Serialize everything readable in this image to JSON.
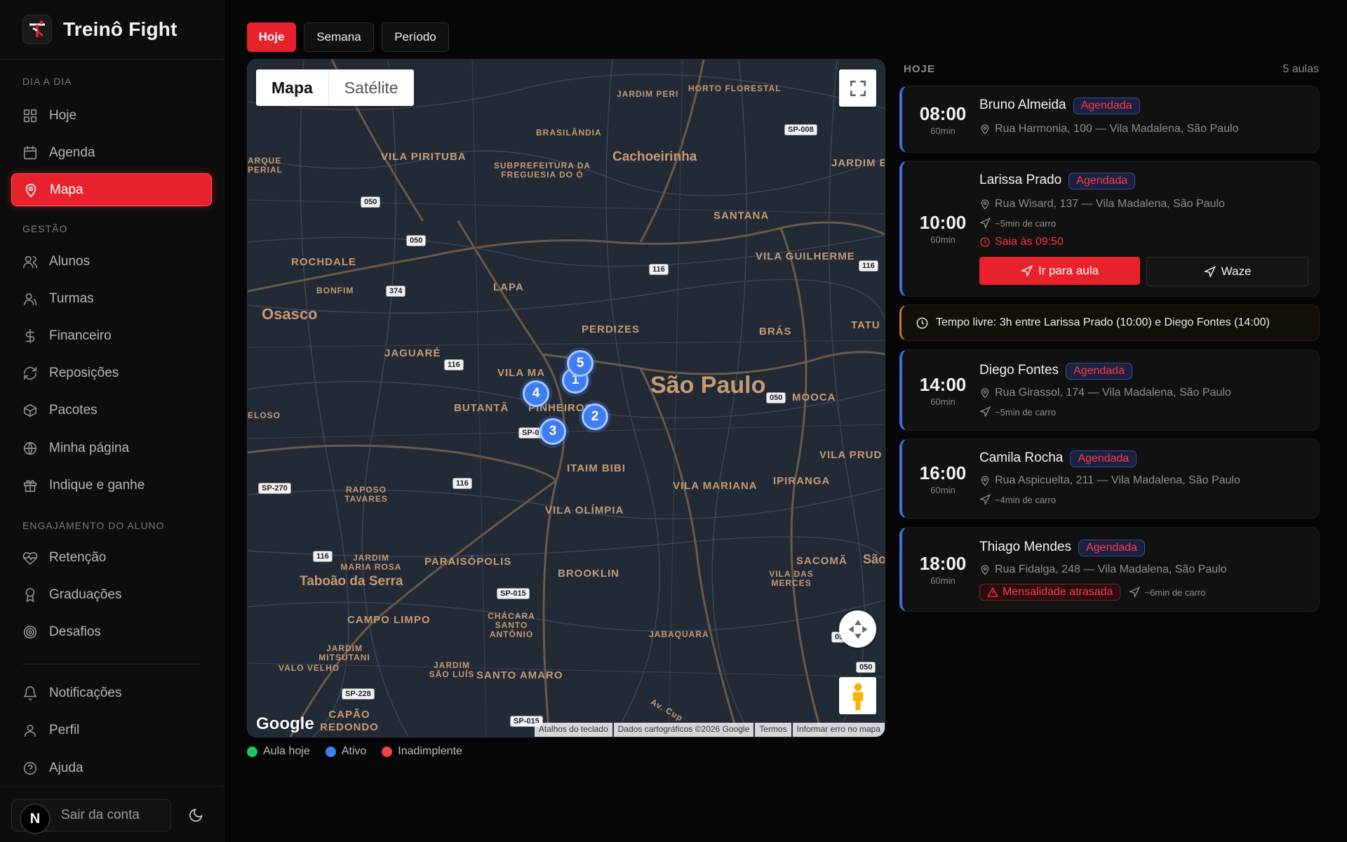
{
  "brand": {
    "name": "Treinô Fight"
  },
  "sidebar": {
    "sections": [
      "DIA A DIA",
      "GESTÃO",
      "ENGAJAMENTO DO ALUNO"
    ],
    "items": [
      {
        "label": "Hoje",
        "icon": "grid-icon"
      },
      {
        "label": "Agenda",
        "icon": "calendar-icon"
      },
      {
        "label": "Mapa",
        "icon": "map-pin-icon",
        "active": true
      },
      {
        "label": "Alunos",
        "icon": "users-icon"
      },
      {
        "label": "Turmas",
        "icon": "users-group-icon"
      },
      {
        "label": "Financeiro",
        "icon": "dollar-icon"
      },
      {
        "label": "Reposições",
        "icon": "refresh-icon"
      },
      {
        "label": "Pacotes",
        "icon": "box-icon"
      },
      {
        "label": "Minha página",
        "icon": "globe-icon"
      },
      {
        "label": "Indique e ganhe",
        "icon": "gift-icon"
      },
      {
        "label": "Retenção",
        "icon": "heart-pulse-icon"
      },
      {
        "label": "Graduações",
        "icon": "award-icon"
      },
      {
        "label": "Desafios",
        "icon": "target-icon"
      },
      {
        "label": "Notificações",
        "icon": "bell-icon"
      },
      {
        "label": "Perfil",
        "icon": "user-icon"
      },
      {
        "label": "Ajuda",
        "icon": "help-icon"
      }
    ],
    "avatar_letter": "N",
    "logout_label": "Sair da conta"
  },
  "tabs": [
    "Hoje",
    "Semana",
    "Período"
  ],
  "map": {
    "toggle": [
      "Mapa",
      "Satélite"
    ],
    "clusters": [
      "1",
      "2",
      "3",
      "4",
      "5"
    ],
    "labels": [
      "São Paulo",
      "Osasco",
      "Cachoeirinha",
      "Taboão da Serra",
      "VILA PIRITUBA",
      "ROCHDALE",
      "LAPA",
      "PERDIZES",
      "SANTANA",
      "VILA GUILHERME",
      "BRÁS",
      "JAGUARÉ",
      "VILA MARIANA",
      "BUTANTÃ",
      "PINHEIROS",
      "ITAIM BIBI",
      "MOOCA",
      "VILA OLÍMPIA",
      "IPIRANGA",
      "PARAISÓPOLIS",
      "BROOKLIN",
      "CAMPO LIMPO",
      "SANTO AMARO",
      "SACOMÃ",
      "CAPÃO REDONDO",
      "BRASILÂNDIA",
      "JARDIM PERI",
      "HORTO FLORESTAL",
      "SUBPREFEITURA DA FREGUESIA DO Ó",
      "BONFIM",
      "RAPOSO TAVARES",
      "JARDIM MARIA ROSA",
      "CHÁCARA SANTO ANTÔNIO",
      "JABAQUARA",
      "VILA DAS MERCES",
      "JARDIM MITSUTANI",
      "VALO VELHO",
      "JARDIM SÃO LUÍS",
      "VILA PRUD",
      "TATU",
      "JARDIM E",
      "ELOSO",
      "ARQUE PERIAL",
      "Av. Cup",
      "VILA MA",
      "São"
    ],
    "shields": [
      "SP-008",
      "050",
      "050",
      "116",
      "116",
      "374",
      "116",
      "050",
      "116",
      "SP-270",
      "116",
      "SP-015",
      "SP-228",
      "SP-015",
      "SP-0",
      "050",
      "05"
    ],
    "google": "Google",
    "attribution": [
      "Atalhos do teclado",
      "Dados cartográficos ©2026 Google",
      "Termos",
      "Informar erro no mapa"
    ]
  },
  "legend": [
    {
      "label": "Aula hoje",
      "color": "#22c55e"
    },
    {
      "label": "Ativo",
      "color": "#3b82f6"
    },
    {
      "label": "Inadimplente",
      "color": "#ef4444"
    }
  ],
  "panel": {
    "title": "HOJE",
    "count": "5 aulas",
    "status_label": "Agendada",
    "classes": [
      {
        "time": "08:00",
        "dur": "60min",
        "name": "Bruno Almeida",
        "address": "Rua Harmonia, 100 — Vila Madalena, São Paulo"
      },
      {
        "time": "10:00",
        "dur": "60min",
        "name": "Larissa Prado",
        "address": "Rua Wisard, 137 — Vila Madalena, São Paulo",
        "drive": "~5min de carro",
        "leave": "Saia às 09:50",
        "go_label": "Ir para aula",
        "waze_label": "Waze"
      },
      {
        "time": "14:00",
        "dur": "60min",
        "name": "Diego Fontes",
        "address": "Rua Girassol, 174 — Vila Madalena, São Paulo",
        "drive": "~5min de carro"
      },
      {
        "time": "16:00",
        "dur": "60min",
        "name": "Camila Rocha",
        "address": "Rua Aspicuelta, 211 — Vila Madalena, São Paulo",
        "drive": "~4min de carro"
      },
      {
        "time": "18:00",
        "dur": "60min",
        "name": "Thiago Mendes",
        "address": "Rua Fidalga, 248 — Vila Madalena, São Paulo",
        "alert": "Mensalidade atrasada",
        "drive": "~6min de carro"
      }
    ],
    "free_time": "Tempo livre: 3h entre Larissa Prado (10:00) e Diego Fontes (14:00)"
  }
}
